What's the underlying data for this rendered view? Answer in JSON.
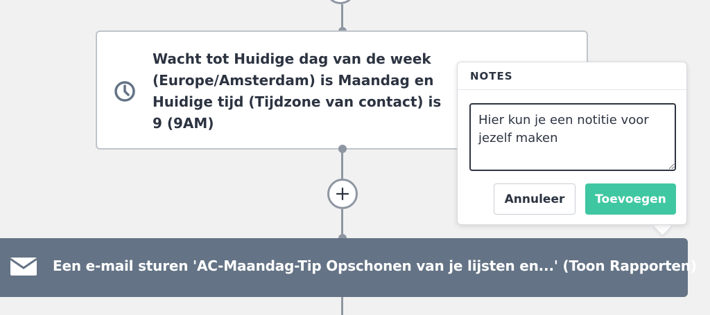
{
  "colors": {
    "background": "#f1f1f1",
    "connector": "#8e96a2",
    "card_text": "#2c3341",
    "email_bar": "#647385",
    "accent_green": "#3fc7a2"
  },
  "wait_step": {
    "icon": "clock-icon",
    "text": "Wacht tot Huidige dag van de week (Europe/Amsterdam) is Maandag en Huidige tijd (Tijdzone van contact) is 9 (9AM)"
  },
  "add_step": {
    "icon": "plus-icon"
  },
  "email_step": {
    "icon": "envelope-icon",
    "text": "Een e-mail sturen 'AC-Maandag-Tip Opschonen van je lijsten en...' (Toon Rapporten)"
  },
  "notes": {
    "title": "NOTES",
    "placeholder": "Hier kun je een notitie voor jezelf maken",
    "value": "",
    "cancel_label": "Annuleer",
    "add_label": "Toevoegen"
  }
}
